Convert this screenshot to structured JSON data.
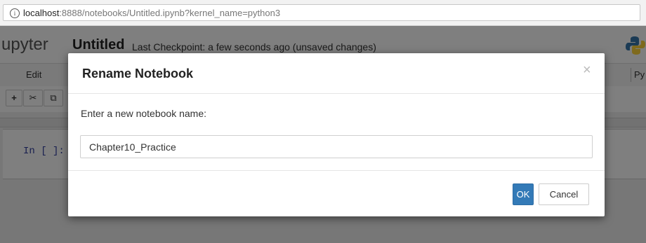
{
  "browser": {
    "url_host": "localhost",
    "url_rest": ":8888/notebooks/Untitled.ipynb?kernel_name=python3",
    "info_glyph": "i"
  },
  "jupyter": {
    "logo_text": "upyter",
    "notebook_title": "Untitled",
    "checkpoint_text": "Last Checkpoint: a few seconds ago (unsaved changes)",
    "menu": {
      "edit": "Edit",
      "kernel_partial": "Py"
    },
    "toolbar": {
      "add": "+",
      "cut": "✂",
      "copy": "⧉"
    },
    "cell_prompt": "In [ ]:"
  },
  "dialog": {
    "title": "Rename Notebook",
    "close_glyph": "×",
    "prompt_label": "Enter a new notebook name:",
    "input_value": "Chapter10_Practice",
    "ok_label": "OK",
    "cancel_label": "Cancel"
  },
  "colors": {
    "primary": "#337ab7",
    "overlay": "rgba(0,0,0,0.5)",
    "prompt_blue": "#303f9f"
  }
}
